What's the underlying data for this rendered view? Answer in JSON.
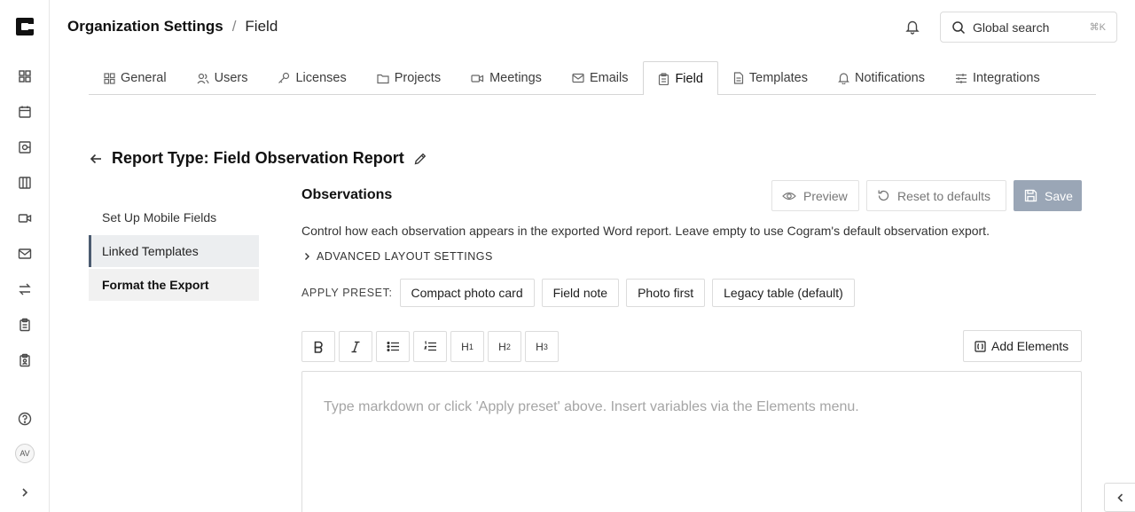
{
  "rail": {
    "avatar_initials": "AV",
    "icons": [
      "logo-icon",
      "dashboard-icon",
      "calendar-icon",
      "meeting-notes-icon",
      "columns-icon",
      "video-icon",
      "mail-icon",
      "transfer-icon",
      "clipboard-icon",
      "badge-icon",
      "help-icon",
      "expand-chevron-icon"
    ]
  },
  "header": {
    "crumb_parent": "Organization Settings",
    "crumb_sep": "/",
    "crumb_current": "Field",
    "search_placeholder": "Global search",
    "search_shortcut": "⌘K"
  },
  "tabs": [
    {
      "label": "General",
      "icon": "grid-icon"
    },
    {
      "label": "Users",
      "icon": "users-icon"
    },
    {
      "label": "Licenses",
      "icon": "key-icon"
    },
    {
      "label": "Projects",
      "icon": "folder-icon"
    },
    {
      "label": "Meetings",
      "icon": "video-icon"
    },
    {
      "label": "Emails",
      "icon": "mail-icon"
    },
    {
      "label": "Field",
      "icon": "clipboard-icon",
      "active": true
    },
    {
      "label": "Templates",
      "icon": "file-icon"
    },
    {
      "label": "Notifications",
      "icon": "bell-icon"
    },
    {
      "label": "Integrations",
      "icon": "sliders-icon"
    }
  ],
  "report": {
    "title": "Report Type: Field Observation Report"
  },
  "sidenav": {
    "items": [
      {
        "label": "Set Up Mobile Fields"
      },
      {
        "label": "Linked Templates"
      },
      {
        "label": "Format the Export"
      }
    ]
  },
  "main": {
    "title": "Observations",
    "preview_label": "Preview",
    "reset_label": "Reset to defaults",
    "save_label": "Save",
    "description": "Control how each observation appears in the exported Word report. Leave empty to use Cogram's default observation export.",
    "advanced_label": "ADVANCED LAYOUT SETTINGS",
    "preset_label": "APPLY PRESET:",
    "presets": [
      "Compact photo card",
      "Field note",
      "Photo first",
      "Legacy table (default)"
    ],
    "toolbar": {
      "h1": "H",
      "h2": "H",
      "h3": "H",
      "h1_sub": "1",
      "h2_sub": "2",
      "h3_sub": "3"
    },
    "add_elements_label": "Add Elements",
    "editor_placeholder": "Type markdown or click 'Apply preset' above. Insert variables via the Elements menu."
  },
  "colors": {
    "save_disabled_bg": "#9aa6b6",
    "active_nav_border": "#4b5b70"
  }
}
